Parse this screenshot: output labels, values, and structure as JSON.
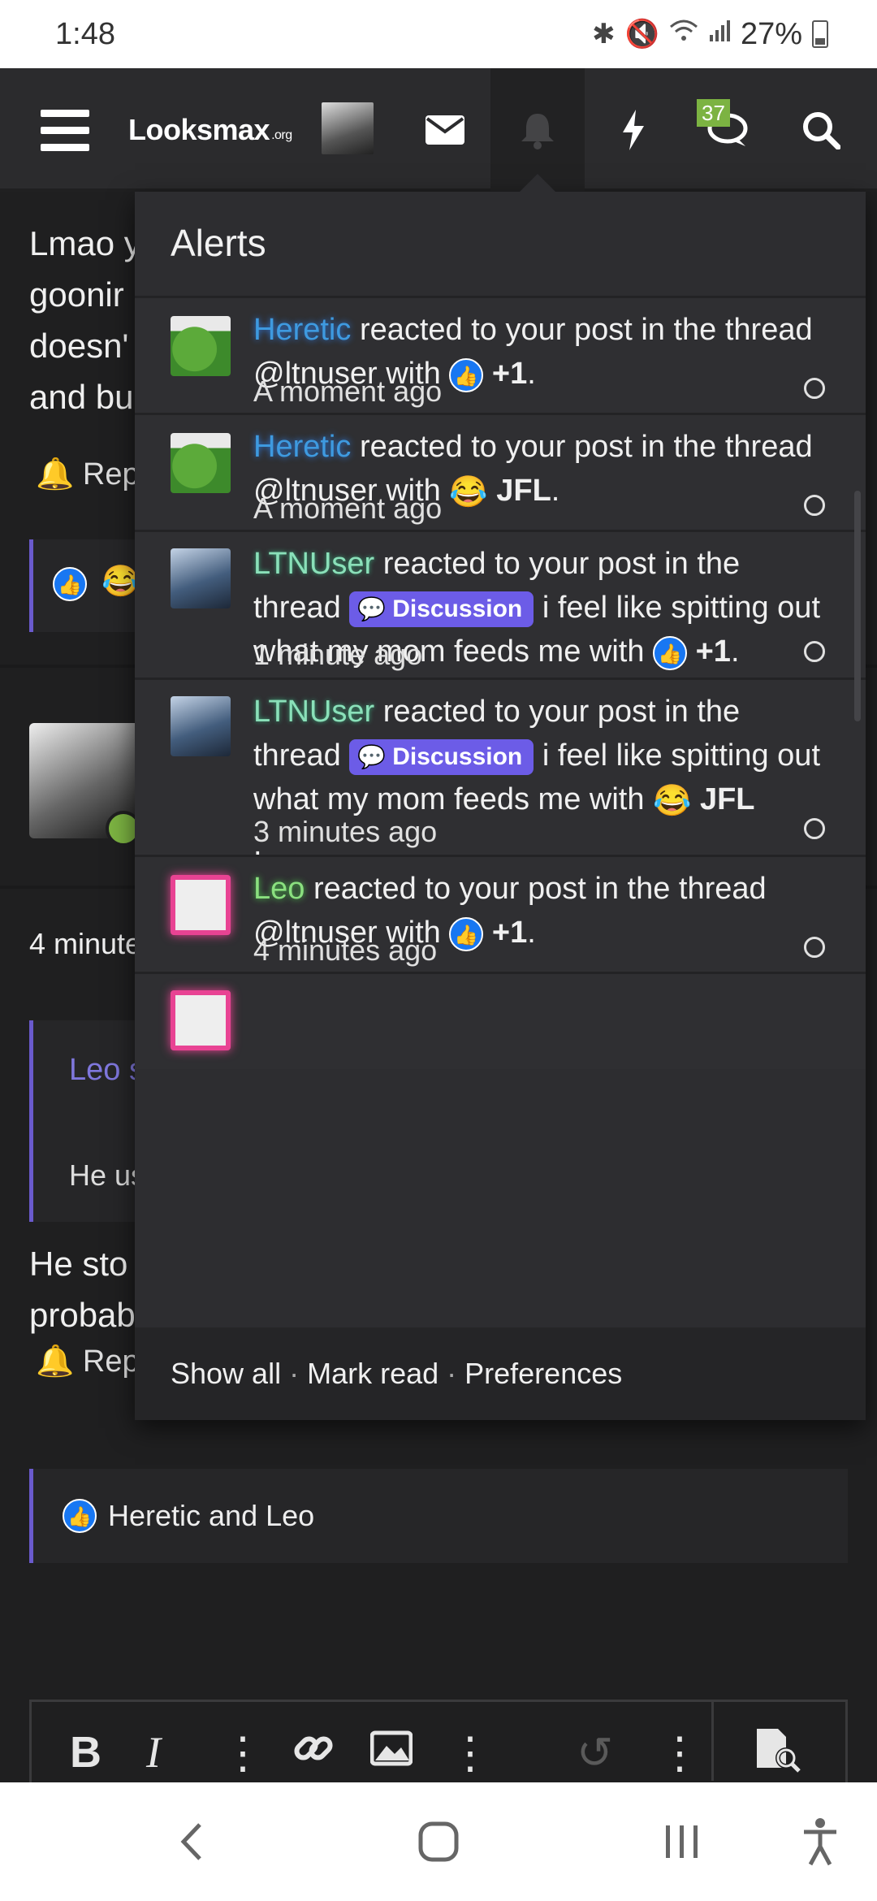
{
  "status_bar": {
    "time": "1:48",
    "battery": "27%",
    "icons": [
      "bluetooth-icon",
      "mute-icon",
      "wifi-icon",
      "signal-icon"
    ]
  },
  "nav": {
    "logo_text": "Looksmax",
    "logo_suffix": ".org",
    "chat_badge": "37"
  },
  "background": {
    "post_lines": [
      "Lmao y",
      "goonir",
      "doesn'",
      "and bu"
    ],
    "report_1": "Repo",
    "time_2": "4 minute",
    "quote_name": "Leo s",
    "quote_text": "He us",
    "post2_lines": [
      "He sto",
      "probab"
    ],
    "report_2": "Repo",
    "reaction_summary": "Heretic and Leo"
  },
  "alerts": {
    "title": "Alerts",
    "items": [
      {
        "user": "Heretic",
        "text_before": "reacted to your post in the thread @ltnuser with",
        "reaction": "+1",
        "suffix": ".",
        "time": "A moment ago"
      },
      {
        "user": "Heretic",
        "text_before": "reacted to your post in the thread @ltnuser with",
        "reaction": "JFL",
        "suffix": ".",
        "time": "A moment ago"
      },
      {
        "user": "LTNUser",
        "text_before": "reacted to your post in the thread",
        "tag": "Discussion",
        "thread": "i feel like spitting out what my mom feeds me with",
        "reaction": "+1",
        "suffix": ".",
        "time": "1 minute ago"
      },
      {
        "user": "LTNUser",
        "text_before": "reacted to your post in the thread",
        "tag": "Discussion",
        "thread": "i feel like spitting out what my mom feeds me with",
        "reaction": "JFL",
        "suffix": ".",
        "time": "3 minutes ago"
      },
      {
        "user": "Leo",
        "text_before": "reacted to your post in the thread @ltnuser with",
        "reaction": "+1",
        "suffix": ".",
        "time": "4 minutes ago"
      }
    ],
    "footer": {
      "show_all": "Show all",
      "mark_read": "Mark read",
      "preferences": "Preferences",
      "separator": "·"
    }
  },
  "colors": {
    "accent": "#6c5ce7",
    "like_blue": "#1877f2",
    "badge_green": "#7cb342",
    "bg": "#1f1f20"
  }
}
